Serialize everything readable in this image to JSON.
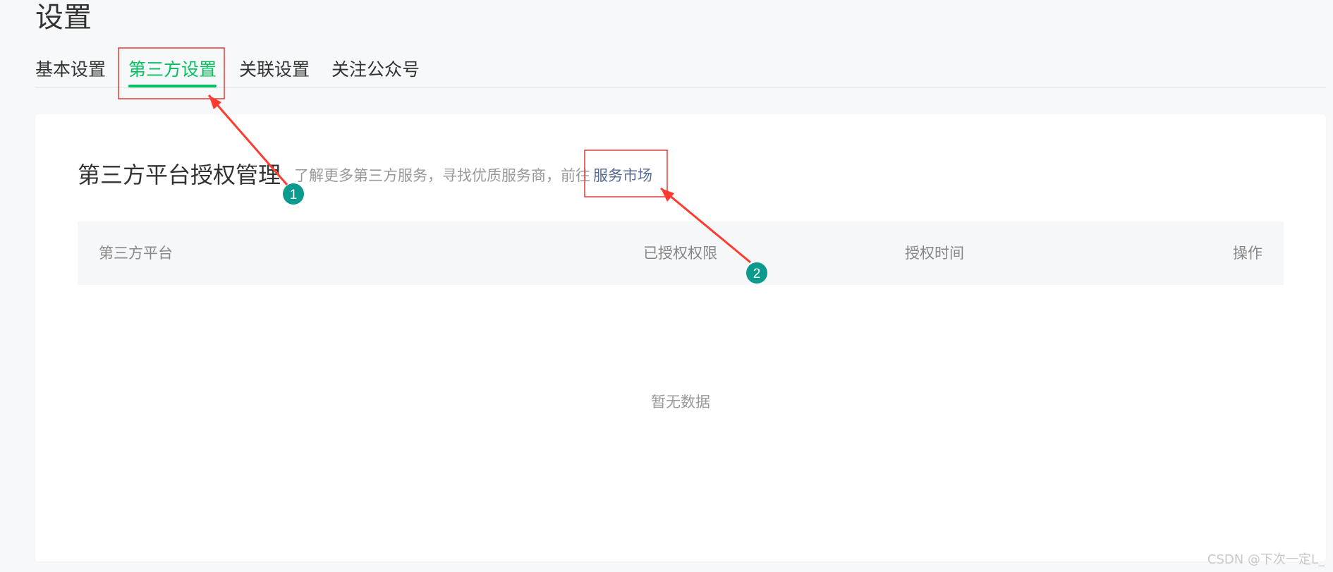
{
  "page": {
    "title": "设置"
  },
  "tabs": [
    {
      "label": "基本设置",
      "active": false
    },
    {
      "label": "第三方设置",
      "active": true
    },
    {
      "label": "关联设置",
      "active": false
    },
    {
      "label": "关注公众号",
      "active": false
    }
  ],
  "section": {
    "title": "第三方平台授权管理",
    "description": "了解更多第三方服务，寻找优质服务商，前往",
    "market_link": "服务市场"
  },
  "table": {
    "columns": [
      "第三方平台",
      "已授权权限",
      "授权时间",
      "操作"
    ],
    "empty_text": "暂无数据"
  },
  "annotations": [
    {
      "number": "1"
    },
    {
      "number": "2"
    }
  ],
  "colors": {
    "accent": "#07c160",
    "link": "#576b95",
    "annotation_box": "#e53935",
    "annotation_badge": "#0a9a8e"
  },
  "watermark": "CSDN @下次一定L_"
}
